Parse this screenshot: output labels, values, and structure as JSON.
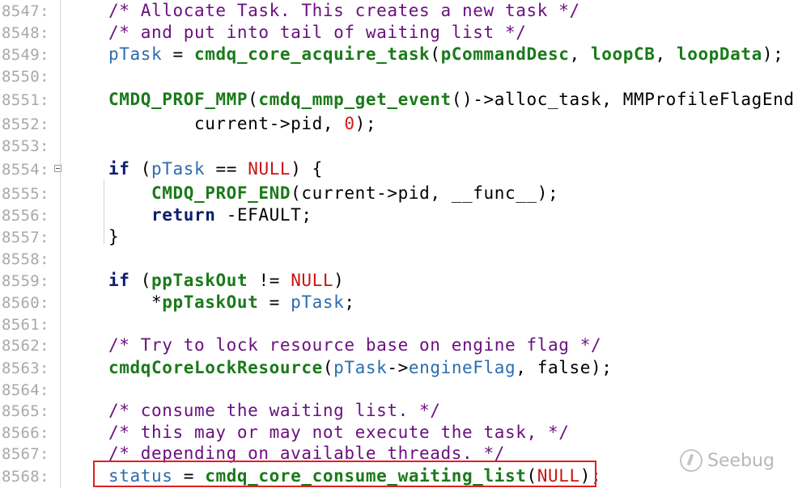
{
  "lines": [
    {
      "num": "8547:",
      "code": "/* Allocate Task. This creates a new task */"
    },
    {
      "num": "8548:",
      "code": "/* and put into tail of waiting list */"
    },
    {
      "num": "8549:",
      "code": "pTask = cmdq_core_acquire_task(pCommandDesc, loopCB, loopData);"
    },
    {
      "num": "8550:",
      "code": ""
    },
    {
      "num": "8551:",
      "code": "CMDQ_PROF_MMP(cmdq_mmp_get_event()->alloc_task, MMProfileFlagEnd,"
    },
    {
      "num": "8552:",
      "code": "        current->pid, 0);"
    },
    {
      "num": "8553:",
      "code": ""
    },
    {
      "num": "8554:",
      "code": "if (pTask == NULL) {"
    },
    {
      "num": "8555:",
      "code": "    CMDQ_PROF_END(current->pid, __func__);"
    },
    {
      "num": "8556:",
      "code": "    return -EFAULT;"
    },
    {
      "num": "8557:",
      "code": "}"
    },
    {
      "num": "8558:",
      "code": ""
    },
    {
      "num": "8559:",
      "code": "if (ppTaskOut != NULL)"
    },
    {
      "num": "8560:",
      "code": "    *ppTaskOut = pTask;"
    },
    {
      "num": "8561:",
      "code": ""
    },
    {
      "num": "8562:",
      "code": "/* Try to lock resource base on engine flag */"
    },
    {
      "num": "8563:",
      "code": "cmdqCoreLockResource(pTask->engineFlag, false);"
    },
    {
      "num": "8564:",
      "code": ""
    },
    {
      "num": "8565:",
      "code": "/* consume the waiting list. */"
    },
    {
      "num": "8566:",
      "code": "/* this may or may not execute the task, */"
    },
    {
      "num": "8567:",
      "code": "/* depending on available threads. */"
    },
    {
      "num": "8568:",
      "code": "status = cmdq_core_consume_waiting_list(NULL);"
    }
  ],
  "watermark": "Seebug"
}
